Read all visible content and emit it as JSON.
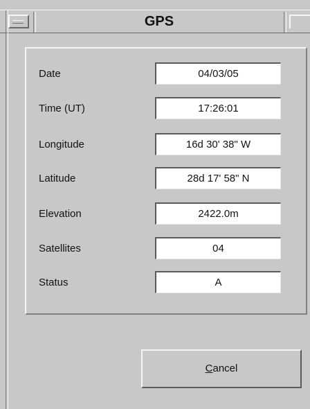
{
  "window": {
    "title": "GPS"
  },
  "fields": [
    {
      "label": "Date",
      "value": "04/03/05"
    },
    {
      "label": "Time (UT)",
      "value": "17:26:01"
    },
    {
      "label": "Longitude",
      "value": "16d 30' 38\" W"
    },
    {
      "label": "Latitude",
      "value": "28d 17' 58\" N"
    },
    {
      "label": "Elevation",
      "value": "2422.0m"
    },
    {
      "label": "Satellites",
      "value": "04"
    },
    {
      "label": "Status",
      "value": "A"
    }
  ],
  "buttons": {
    "cancel_mnemonic": "C",
    "cancel_rest": "ancel"
  }
}
